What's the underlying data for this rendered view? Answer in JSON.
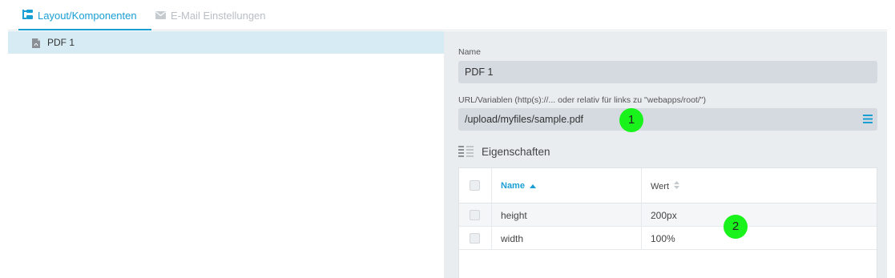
{
  "tabs": [
    {
      "label": "Layout/Komponenten",
      "icon": "tree-structure-icon",
      "active": true,
      "color": "#1a9fd4"
    },
    {
      "label": "E-Mail Einstellungen",
      "icon": "envelope-icon",
      "active": false,
      "color": "#b9bfc4"
    }
  ],
  "tree": {
    "items": [
      {
        "label": "PDF 1",
        "icon": "pdf-file-icon",
        "selected": true
      }
    ]
  },
  "form": {
    "name_label": "Name",
    "name_value": "PDF 1",
    "url_label": "URL/Variablen (http(s)://... oder relativ für links zu \"webapps/root/\")",
    "url_value": "/upload/myfiles/sample.pdf",
    "url_menu_icon": "hamburger-menu-icon"
  },
  "markers": [
    "1",
    "2"
  ],
  "properties": {
    "title": "Eigenschaften",
    "icon": "list-columns-icon",
    "columns": [
      {
        "label": "Name",
        "sort": "ascending"
      },
      {
        "label": "Wert",
        "sort": "none"
      }
    ],
    "rows": [
      {
        "name": "height",
        "value": "200px"
      },
      {
        "name": "width",
        "value": "100%"
      }
    ]
  },
  "colors": {
    "accent": "#1a9fd4",
    "selected_row": "#d6ebf4",
    "panel_bg": "#e9edf0",
    "input_bg": "#d4dae0",
    "marker": "#19f21b"
  }
}
